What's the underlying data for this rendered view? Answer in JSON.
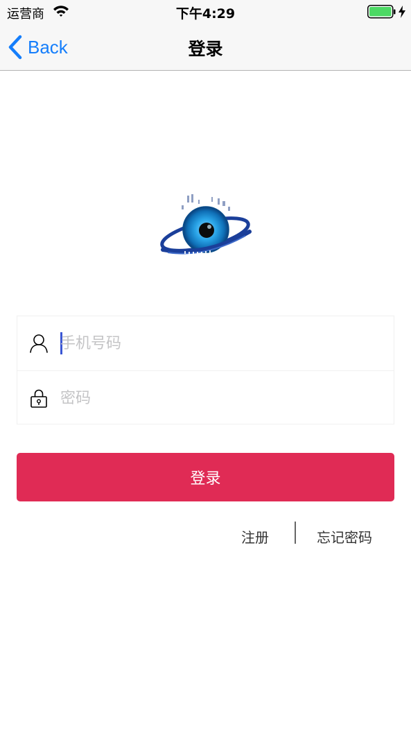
{
  "status_bar": {
    "carrier": "运营商",
    "time": "下午4:29",
    "wifi_icon": "wifi-icon",
    "battery_icon": "battery-icon",
    "charging_icon": "charging-bolt-icon",
    "battery_level": 1.0,
    "battery_color": "#4cd964"
  },
  "nav": {
    "back_label": "Back",
    "title": "登录",
    "back_icon": "chevron-left-icon",
    "accent_color": "#157efb"
  },
  "logo": {
    "icon": "eye-globe-logo"
  },
  "form": {
    "phone": {
      "placeholder": "手机号码",
      "value": "",
      "icon": "user-icon"
    },
    "password": {
      "placeholder": "密码",
      "value": "",
      "icon": "lock-icon"
    }
  },
  "actions": {
    "login_label": "登录",
    "login_color": "#e02b55",
    "register_label": "注册",
    "forgot_label": "忘记密码"
  }
}
